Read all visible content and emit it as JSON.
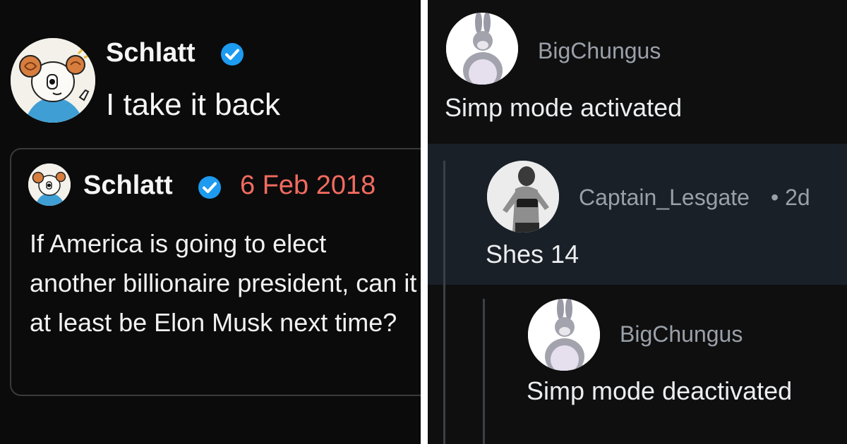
{
  "tweet": {
    "author": "Schlatt",
    "text": "I take it back",
    "verified_color": "#1d9bf0",
    "quote": {
      "author": "Schlatt",
      "date": "6 Feb 2018",
      "text": "If America is going to elect another billionaire president, can it at least be Elon Musk next time?"
    }
  },
  "comments": [
    {
      "user": "BigChungus",
      "body": "Simp mode activated"
    },
    {
      "user": "Captain_Lesgate",
      "time": "• 2d",
      "body": "Shes 14"
    },
    {
      "user": "BigChungus",
      "body": "Simp mode deactivated"
    }
  ],
  "colors": {
    "tweet_bg": "#0b0b0c",
    "date_red": "#f26b5f",
    "comment_highlight": "#1a2028",
    "username_gray": "#9aa0a8"
  }
}
